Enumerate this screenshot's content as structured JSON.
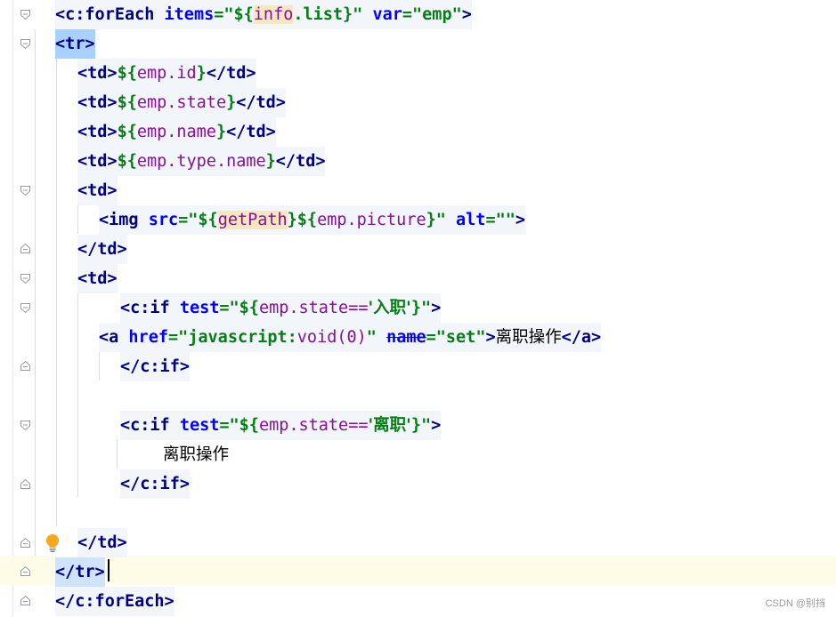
{
  "editor": {
    "lines": [
      {
        "segs": [
          [
            "<c:forEach ",
            "tag"
          ],
          [
            "items",
            "attr"
          ],
          [
            "=\"${",
            "str"
          ],
          [
            "info",
            "el-hl"
          ],
          [
            ".list}\" ",
            "str"
          ],
          [
            "var",
            "attr"
          ],
          [
            "=\"emp\"",
            "str"
          ],
          [
            ">",
            "tag"
          ]
        ]
      },
      {
        "segs": [
          [
            "<tr>",
            "tag"
          ]
        ]
      },
      {
        "segs": [
          [
            "<td>",
            "tag"
          ],
          [
            "${",
            "str"
          ],
          [
            "emp.id",
            "el"
          ],
          [
            "}",
            "str"
          ],
          [
            "</td>",
            "tag"
          ]
        ]
      },
      {
        "segs": [
          [
            "<td>",
            "tag"
          ],
          [
            "${",
            "str"
          ],
          [
            "emp.state",
            "el"
          ],
          [
            "}",
            "str"
          ],
          [
            "</td>",
            "tag"
          ]
        ]
      },
      {
        "segs": [
          [
            "<td>",
            "tag"
          ],
          [
            "${",
            "str"
          ],
          [
            "emp.name",
            "el"
          ],
          [
            "}",
            "str"
          ],
          [
            "</td>",
            "tag"
          ]
        ]
      },
      {
        "segs": [
          [
            "<td>",
            "tag"
          ],
          [
            "${",
            "str"
          ],
          [
            "emp.type.name",
            "el"
          ],
          [
            "}",
            "str"
          ],
          [
            "</td>",
            "tag"
          ]
        ]
      },
      {
        "segs": [
          [
            "<td>",
            "tag"
          ]
        ]
      },
      {
        "segs": [
          [
            "<img ",
            "tag"
          ],
          [
            "src",
            "attr"
          ],
          [
            "=\"${",
            "str"
          ],
          [
            "getPath",
            "el-hl"
          ],
          [
            "}${",
            "str"
          ],
          [
            "emp.picture",
            "el"
          ],
          [
            "}\" ",
            "str"
          ],
          [
            "alt",
            "attr"
          ],
          [
            "=\"\"",
            "str"
          ],
          [
            ">",
            "tag"
          ]
        ]
      },
      {
        "segs": [
          [
            "</td>",
            "tag"
          ]
        ]
      },
      {
        "segs": [
          [
            "<td>",
            "tag"
          ]
        ]
      },
      {
        "segs": [
          [
            "<c:if ",
            "tag"
          ],
          [
            "test",
            "attr"
          ],
          [
            "=\"${",
            "str"
          ],
          [
            "emp.state==",
            "el"
          ],
          [
            "'入职'",
            "str"
          ],
          [
            "}\"",
            "str"
          ],
          [
            ">",
            "tag"
          ]
        ]
      },
      {
        "segs": [
          [
            "<a ",
            "tag"
          ],
          [
            "href",
            "attr"
          ],
          [
            "=\"",
            "str"
          ],
          [
            "javascript:",
            "str"
          ],
          [
            "void",
            "el"
          ],
          [
            "(0)",
            "el"
          ],
          [
            "\" ",
            "str"
          ],
          [
            "name",
            "attr"
          ],
          [
            "=\"set\"",
            "str"
          ],
          [
            ">",
            "tag"
          ],
          [
            "离职操作",
            "txt"
          ],
          [
            "</a>",
            "tag"
          ]
        ]
      },
      {
        "segs": [
          [
            "</c:if>",
            "tag"
          ]
        ]
      },
      {
        "segs": []
      },
      {
        "segs": [
          [
            "<c:if ",
            "tag"
          ],
          [
            "test",
            "attr"
          ],
          [
            "=\"${",
            "str"
          ],
          [
            "emp.state==",
            "el"
          ],
          [
            "'离职'",
            "str"
          ],
          [
            "}\"",
            "str"
          ],
          [
            ">",
            "tag"
          ]
        ]
      },
      {
        "segs": [
          [
            "离职操作",
            "txt"
          ]
        ]
      },
      {
        "segs": [
          [
            "</c:if>",
            "tag"
          ]
        ]
      },
      {
        "segs": []
      },
      {
        "segs": [
          [
            "</td>",
            "tag"
          ]
        ]
      },
      {
        "segs": [
          [
            "</tr>",
            "tag"
          ]
        ]
      },
      {
        "segs": [
          [
            "</c:forEach>",
            "tag"
          ]
        ]
      }
    ]
  },
  "watermark": "CSDN @别挡"
}
